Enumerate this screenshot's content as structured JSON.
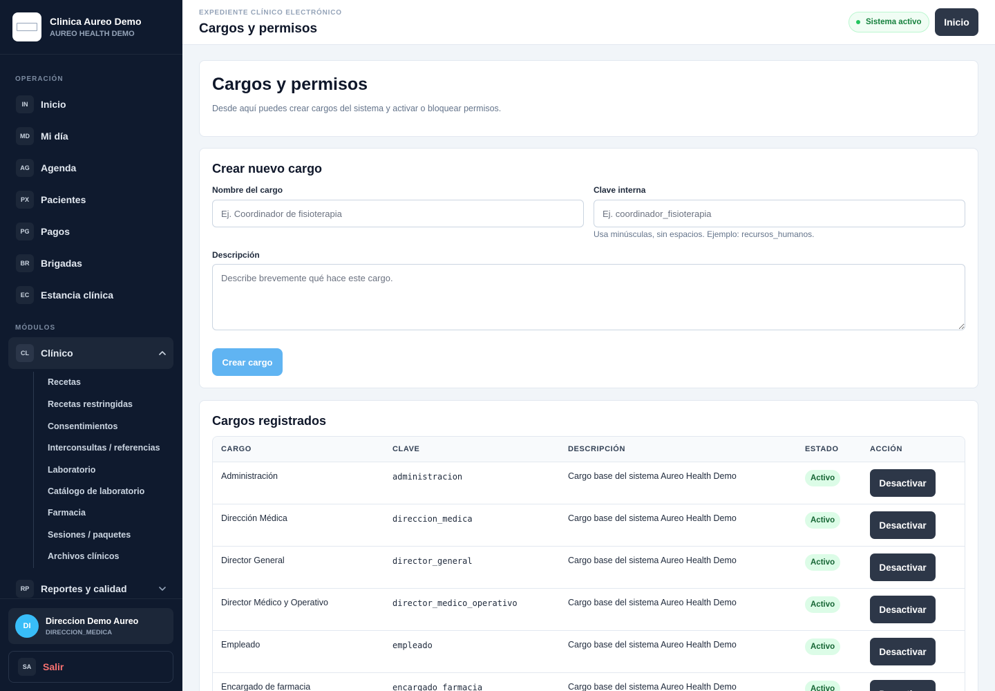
{
  "brand": {
    "name": "Clinica Aureo Demo",
    "subtitle": "AUREO HEALTH DEMO"
  },
  "sidebar": {
    "section_operacion": "OPERACIÓN",
    "section_modulos": "MÓDULOS",
    "nav": [
      {
        "badge": "IN",
        "label": "Inicio"
      },
      {
        "badge": "MD",
        "label": "Mi día"
      },
      {
        "badge": "AG",
        "label": "Agenda"
      },
      {
        "badge": "PX",
        "label": "Pacientes"
      },
      {
        "badge": "PG",
        "label": "Pagos"
      },
      {
        "badge": "BR",
        "label": "Brigadas"
      },
      {
        "badge": "EC",
        "label": "Estancia clínica"
      }
    ],
    "clinico": {
      "badge": "CL",
      "label": "Clínico",
      "expanded": true
    },
    "clinico_items": [
      "Recetas",
      "Recetas restringidas",
      "Consentimientos",
      "Interconsultas / referencias",
      "Laboratorio",
      "Catálogo de laboratorio",
      "Farmacia",
      "Sesiones / paquetes",
      "Archivos clínicos"
    ],
    "reportes": {
      "badge": "RP",
      "label": "Reportes y calidad",
      "expanded": false
    },
    "user": {
      "initials": "DI",
      "name": "Direccion Demo Aureo",
      "role": "DIRECCION_MEDICA"
    },
    "logout": {
      "badge": "SA",
      "label": "Salir"
    }
  },
  "topbar": {
    "eyebrow": "EXPEDIENTE CLÍNICO ELECTRÓNICO",
    "title": "Cargos y permisos",
    "status": "Sistema activo",
    "home_button": "Inicio"
  },
  "hero": {
    "title": "Cargos y permisos",
    "subtitle": "Desde aquí puedes crear cargos del sistema y activar o bloquear permisos."
  },
  "form": {
    "title": "Crear nuevo cargo",
    "name_label": "Nombre del cargo",
    "name_placeholder": "Ej. Coordinador de fisioterapia",
    "key_label": "Clave interna",
    "key_placeholder": "Ej. coordinador_fisioterapia",
    "key_hint": "Usa minúsculas, sin espacios. Ejemplo: recursos_humanos.",
    "desc_label": "Descripción",
    "desc_placeholder": "Describe brevemente qué hace este cargo.",
    "submit": "Crear cargo"
  },
  "table": {
    "title": "Cargos registrados",
    "headers": {
      "cargo": "CARGO",
      "clave": "CLAVE",
      "descripcion": "DESCRIPCIÓN",
      "estado": "ESTADO",
      "accion": "ACCIÓN"
    },
    "rows": [
      {
        "cargo": "Administración",
        "clave": "administracion",
        "descripcion": "Cargo base del sistema Aureo Health Demo",
        "estado": "Activo",
        "accion": "Desactivar"
      },
      {
        "cargo": "Dirección Médica",
        "clave": "direccion_medica",
        "descripcion": "Cargo base del sistema Aureo Health Demo",
        "estado": "Activo",
        "accion": "Desactivar"
      },
      {
        "cargo": "Director General",
        "clave": "director_general",
        "descripcion": "Cargo base del sistema Aureo Health Demo",
        "estado": "Activo",
        "accion": "Desactivar"
      },
      {
        "cargo": "Director Médico y Operativo",
        "clave": "director_medico_operativo",
        "descripcion": "Cargo base del sistema Aureo Health Demo",
        "estado": "Activo",
        "accion": "Desactivar"
      },
      {
        "cargo": "Empleado",
        "clave": "empleado",
        "descripcion": "Cargo base del sistema Aureo Health Demo",
        "estado": "Activo",
        "accion": "Desactivar"
      },
      {
        "cargo": "Encargado de farmacia",
        "clave": "encargado_farmacia",
        "descripcion": "Cargo base del sistema Aureo Health Demo",
        "estado": "Activo",
        "accion": "Desactivar"
      }
    ]
  },
  "colors": {
    "sidebar_bg": "#0f1a2e",
    "primary_dark": "#2d3748",
    "create_button": "#60b4f2",
    "active_green": "#166534",
    "logout_red": "#f87171"
  }
}
